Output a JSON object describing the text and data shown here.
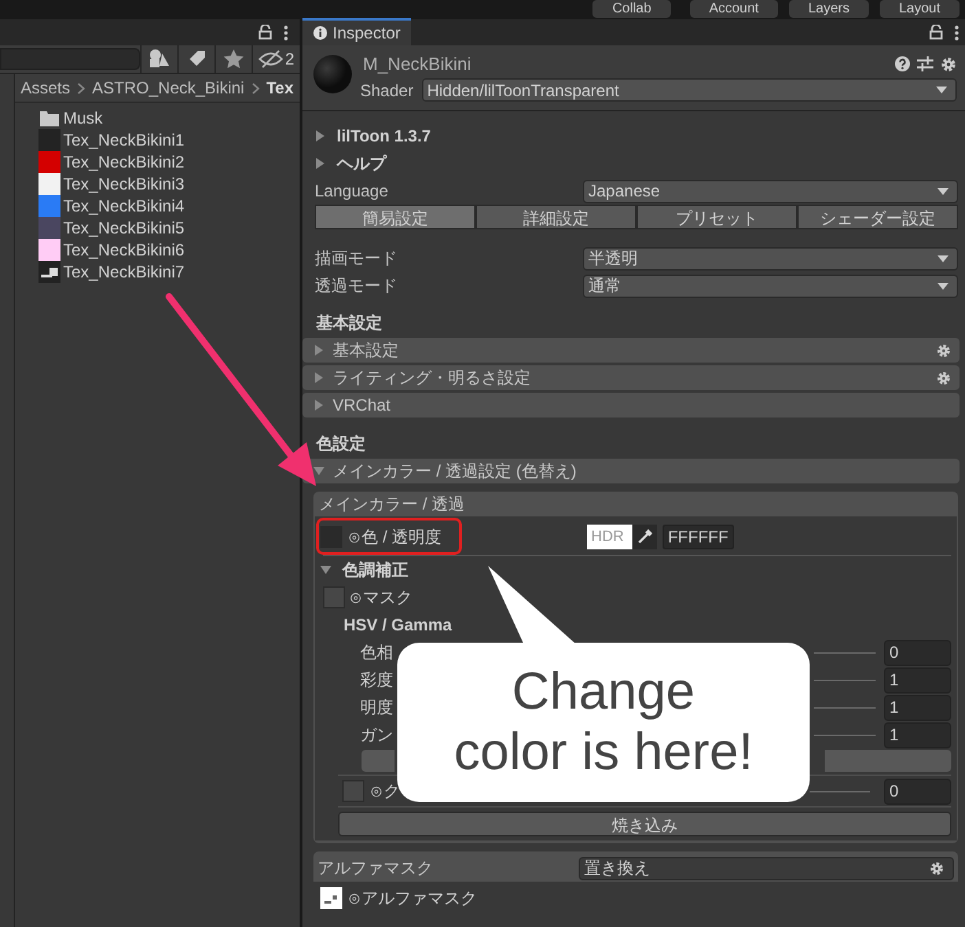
{
  "toolbar": {
    "buttons": [
      {
        "label": "Collab"
      },
      {
        "label": "Account"
      },
      {
        "label": "Layers"
      },
      {
        "label": "Layout"
      }
    ]
  },
  "project": {
    "hidden_count": "2",
    "breadcrumb": [
      "Assets",
      "ASTRO_Neck_Bikini",
      "Tex"
    ],
    "items": [
      {
        "name": "Musk",
        "kind": "folder"
      },
      {
        "name": "Tex_NeckBikini1",
        "kind": "swatch",
        "color": "#232323"
      },
      {
        "name": "Tex_NeckBikini2",
        "kind": "swatch",
        "color": "#d40000"
      },
      {
        "name": "Tex_NeckBikini3",
        "kind": "swatch",
        "color": "#f2f2f2"
      },
      {
        "name": "Tex_NeckBikini4",
        "kind": "swatch",
        "color": "#2a7bf5"
      },
      {
        "name": "Tex_NeckBikini5",
        "kind": "swatch",
        "color": "#4a4660"
      },
      {
        "name": "Tex_NeckBikini6",
        "kind": "swatch",
        "color": "#ffccf5"
      },
      {
        "name": "Tex_NeckBikini7",
        "kind": "image"
      }
    ]
  },
  "inspector": {
    "tab": "Inspector",
    "material": "M_NeckBikini",
    "shader_label": "Shader",
    "shader": "Hidden/lilToonTransparent",
    "foldouts": [
      {
        "label": "lilToon 1.3.7",
        "expanded": false
      },
      {
        "label": "ヘルプ",
        "expanded": false
      }
    ],
    "language": {
      "label": "Language",
      "value": "Japanese"
    },
    "mode_tabs": [
      {
        "label": "簡易設定",
        "selected": true
      },
      {
        "label": "詳細設定",
        "selected": false
      },
      {
        "label": "プリセット",
        "selected": false
      },
      {
        "label": "シェーダー設定",
        "selected": false
      }
    ],
    "fields": [
      {
        "label": "描画モード",
        "value": "半透明"
      },
      {
        "label": "透過モード",
        "value": "通常"
      }
    ],
    "sections": [
      {
        "title": "基本設定",
        "groups": [
          {
            "label": "基本設定",
            "expanded": false,
            "settings": true
          },
          {
            "label": "ライティング・明るさ設定",
            "expanded": false,
            "settings": true
          },
          {
            "label": "VRChat",
            "expanded": false,
            "settings": false
          }
        ]
      },
      {
        "title": "色設定",
        "groups": [
          {
            "label": "メインカラー / 透過設定 (色替え)",
            "expanded": true,
            "settings": false
          }
        ]
      }
    ],
    "main_color": {
      "title": "メインカラー / 透過",
      "color_label": "⊙色 / 透明度",
      "hdr": "HDR",
      "hex": "FFFFFF",
      "adjust": {
        "label": "色調補正",
        "expanded": true,
        "mask_label": "⊙マスク",
        "hsv_title": "HSV / Gamma",
        "sliders": [
          {
            "label": "色相",
            "value": "0"
          },
          {
            "label": "彩度",
            "value": "1"
          },
          {
            "label": "明度",
            "value": "1"
          },
          {
            "label": "ガン",
            "value": "1"
          }
        ],
        "extra_label": "⊙ク",
        "extra_value": "0"
      },
      "bake": "焼き込み"
    },
    "alpha_mask": {
      "label": "アルファマスク",
      "mode": "置き換え",
      "texture_label": "⊙アルファマスク"
    }
  },
  "callout": {
    "text": "Change\ncolor is here!"
  }
}
